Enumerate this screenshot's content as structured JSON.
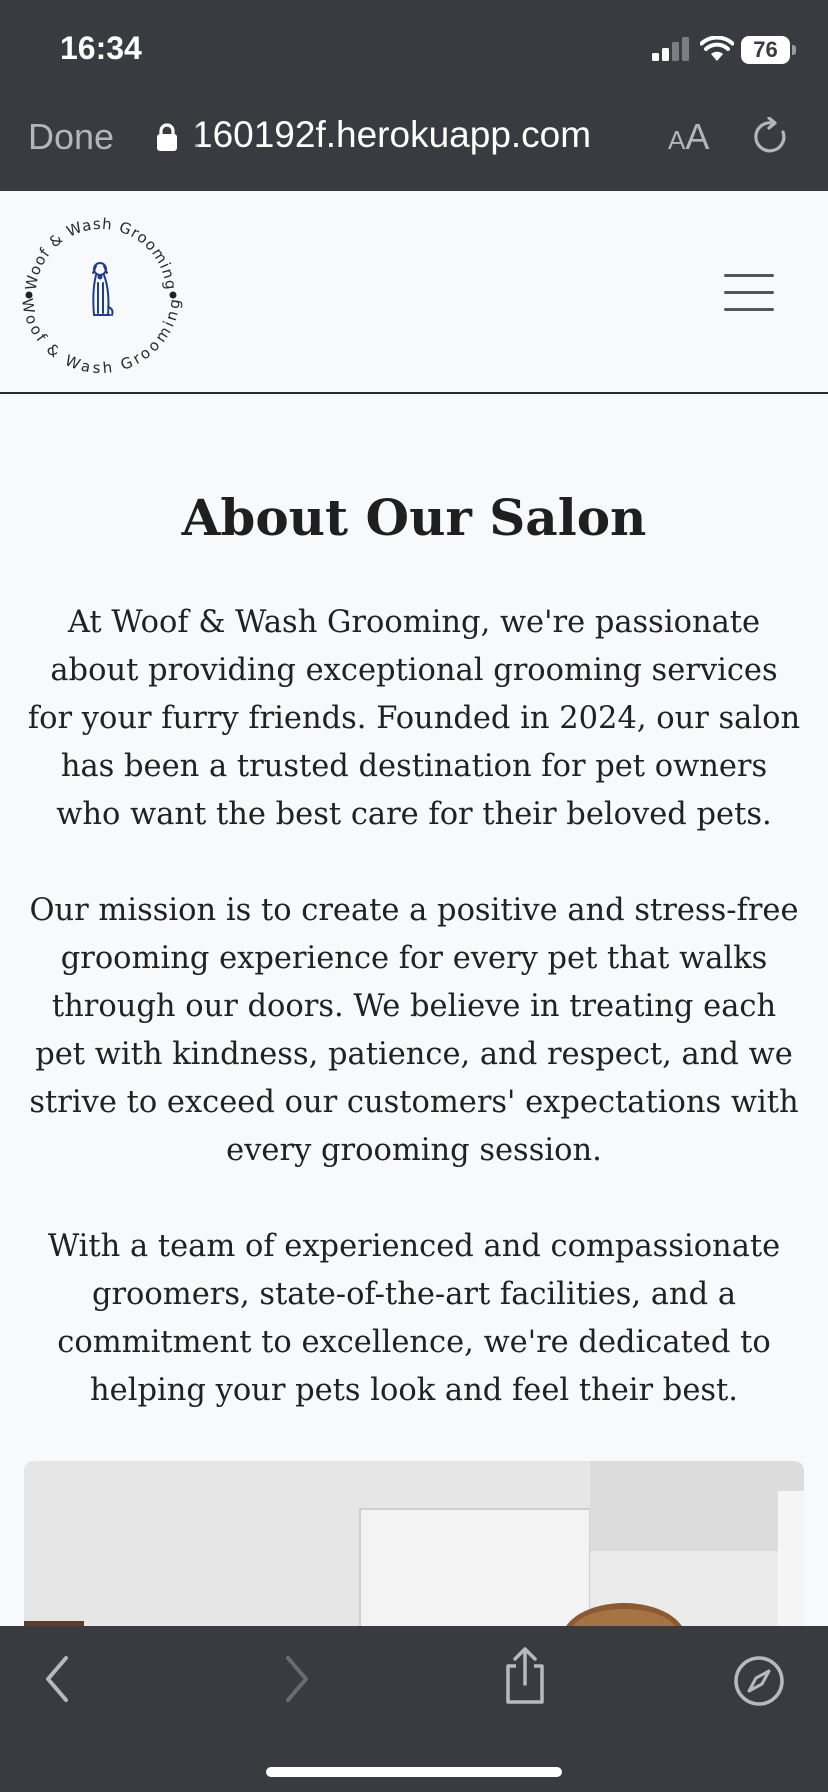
{
  "status_bar": {
    "time": "16:34",
    "battery": "76",
    "signal_icon": "cellular-signal-icon",
    "wifi_icon": "wifi-icon"
  },
  "browser": {
    "done_label": "Done",
    "url": "160192f.herokuapp.com",
    "text_size_label_small": "A",
    "text_size_label_big": "A",
    "lock_icon": "lock-icon",
    "reload_icon": "reload-icon"
  },
  "site": {
    "logo_text_top": "Woof & Wash Grooming",
    "logo_text_bottom": "Woof & Wash Grooming",
    "menu_icon": "hamburger-menu-icon"
  },
  "about": {
    "title": "About Our Salon",
    "paragraphs": [
      "At Woof & Wash Grooming, we're passionate about providing exceptional grooming services for your furry friends. Founded in 2024, our salon has been a trusted destination for pet owners who want the best care for their beloved pets.",
      "Our mission is to create a positive and stress-free grooming experience for every pet that walks through our doors. We believe in treating each pet with kindness, patience, and respect, and we strive to exceed our customers' expectations with every grooming session.",
      "With a team of experienced and compassionate groomers, state-of-the-art facilities, and a commitment to excellence, we're dedicated to helping your pets look and feel their best."
    ]
  },
  "toolbar": {
    "back_icon": "chevron-left-icon",
    "forward_icon": "chevron-right-icon",
    "share_icon": "share-icon",
    "compass_icon": "compass-icon"
  },
  "colors": {
    "chrome": "#3a3b40",
    "page_background": "#f8f9fa",
    "logo_blue": "#1f3f8a",
    "text": "#212121"
  }
}
